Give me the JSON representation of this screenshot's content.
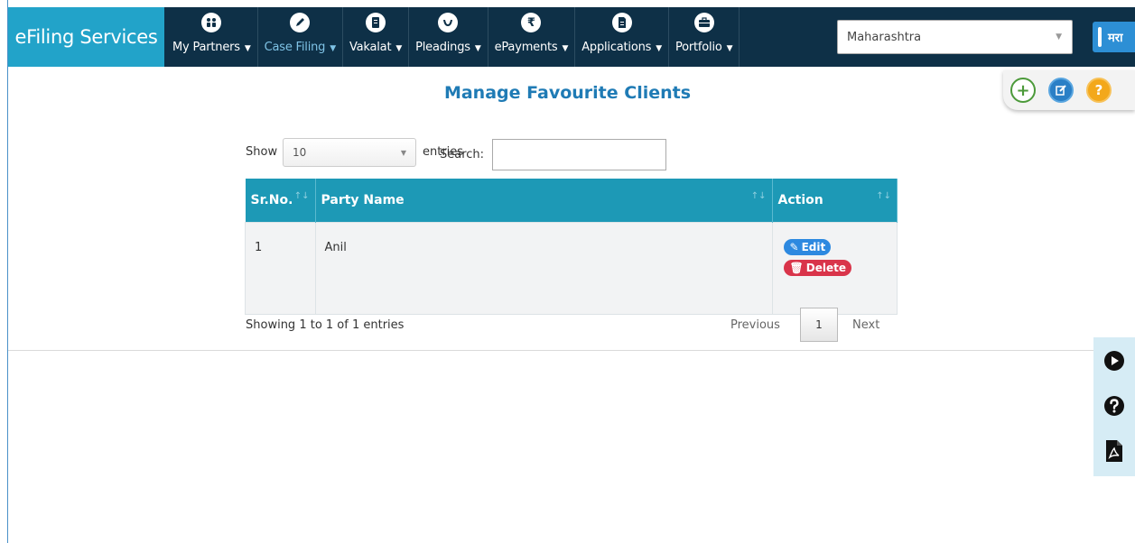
{
  "header": {
    "brand": "eFiling Services",
    "nav": [
      {
        "label": "My Partners",
        "icon": "partners-icon"
      },
      {
        "label": "Case Filing",
        "icon": "pencil-icon"
      },
      {
        "label": "Vakalat",
        "icon": "document-icon"
      },
      {
        "label": "Pleadings",
        "icon": "hands-icon"
      },
      {
        "label": "ePayments",
        "icon": "rupee-icon"
      },
      {
        "label": "Applications",
        "icon": "file-icon"
      },
      {
        "label": "Portfolio",
        "icon": "briefcase-icon"
      }
    ],
    "state_select": "Maharashtra",
    "language_button": "मरा"
  },
  "quick_actions": {
    "help": "?"
  },
  "page": {
    "title": "Manage Favourite Clients",
    "length": {
      "show_label": "Show",
      "value": "10",
      "entries_label": "entries"
    },
    "search": {
      "label": "Search:",
      "value": ""
    },
    "table": {
      "headers": [
        "Sr.No.",
        "Party Name",
        "Action"
      ],
      "rows": [
        {
          "sr": "1",
          "party": "Anil",
          "edit_label": "Edit",
          "delete_label": "Delete"
        }
      ]
    },
    "info": "Showing 1 to 1 of 1 entries",
    "pagination": {
      "previous": "Previous",
      "current": "1",
      "next": "Next"
    }
  },
  "colors": {
    "brand_bg": "#22a3c9",
    "topbar_bg": "#0e3047",
    "title": "#1f7bb5",
    "table_header": "#1d99b6",
    "edit_button": "#2d89e0",
    "delete_button": "#d9344a"
  }
}
